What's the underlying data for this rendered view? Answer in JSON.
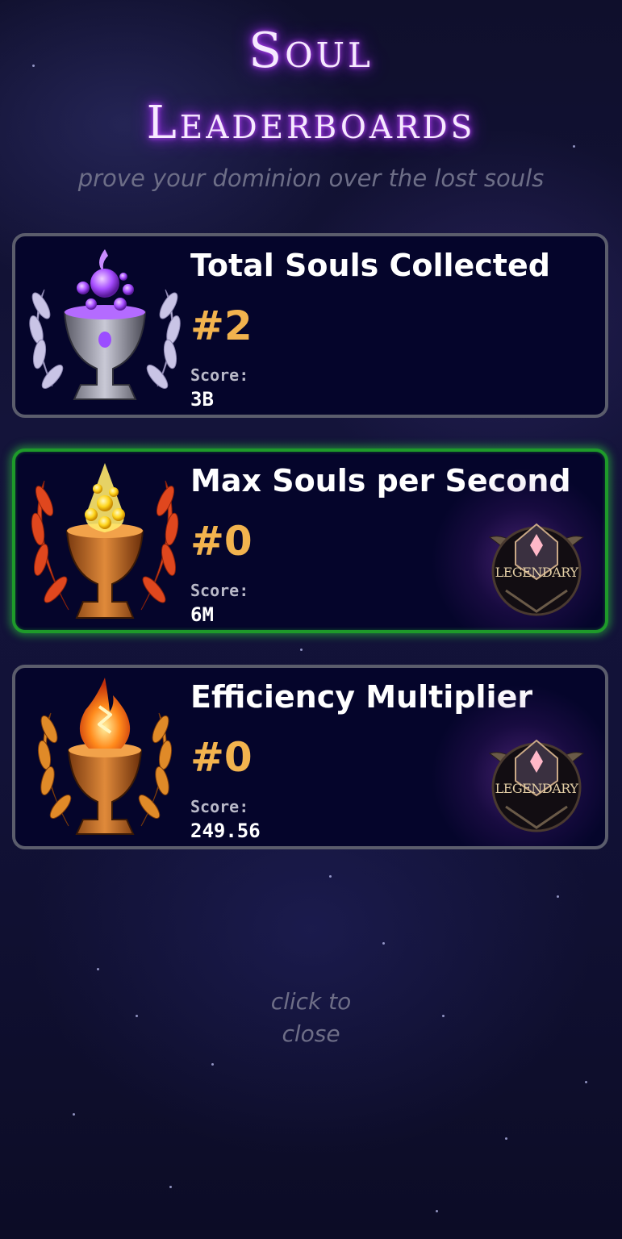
{
  "header": {
    "title_line1": "Soul",
    "title_line2": "Leaderboards",
    "subtitle": "prove your dominion over the lost souls"
  },
  "leaderboards": [
    {
      "title": "Total Souls Collected",
      "rank": "#2",
      "score_label": "Score:",
      "score": "3B",
      "trophy_icon": "purple-chalice-laurel-icon",
      "highlighted": false,
      "badge": null
    },
    {
      "title": "Max Souls per Second",
      "rank": "#0",
      "score_label": "Score:",
      "score": "6M",
      "trophy_icon": "golden-flame-chalice-laurel-icon",
      "highlighted": true,
      "badge": "LEGENDARY"
    },
    {
      "title": "Efficiency Multiplier",
      "rank": "#0",
      "score_label": "Score:",
      "score": "249.56",
      "trophy_icon": "rune-fire-chalice-laurel-icon",
      "highlighted": false,
      "badge": "LEGENDARY"
    }
  ],
  "footer": {
    "close_line1": "click to",
    "close_line2": "close"
  },
  "colors": {
    "rank": "#f2b34e",
    "highlight_border": "#1e9a2a",
    "card_border": "#5b5d6c",
    "title_glow": "#a230ff"
  }
}
